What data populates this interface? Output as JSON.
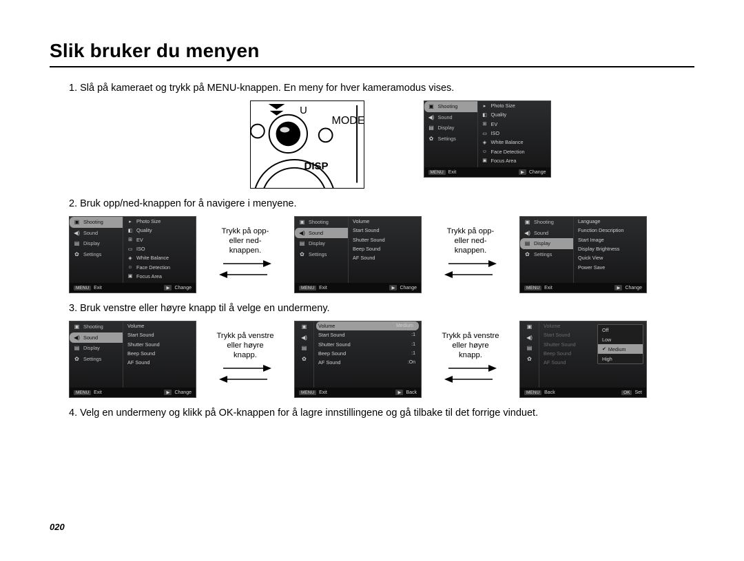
{
  "title": "Slik bruker du menyen",
  "steps": {
    "s1": "1. Slå på kameraet og trykk på MENU-knappen. En meny for hver kameramodus vises.",
    "s2": "2. Bruk opp/ned-knappen for å navigere i menyene.",
    "s3": "3. Bruk venstre eller høyre knapp til å velge en undermeny.",
    "s4": "4. Velg en undermeny og klikk på OK-knappen for å lagre innstillingene og gå tilbake til det forrige vinduet."
  },
  "camera_labels": {
    "mode": "MODE",
    "disp": "DISP"
  },
  "tabs": {
    "shooting": "Shooting",
    "sound": "Sound",
    "display": "Display",
    "settings": "Settings"
  },
  "shooting_items": [
    "Photo Size",
    "Quality",
    "EV",
    "ISO",
    "White Balance",
    "Face Detection",
    "Focus Area"
  ],
  "sound_items": [
    "Volume",
    "Start Sound",
    "Shutter Sound",
    "Beep Sound",
    "AF Sound"
  ],
  "display_items": [
    "Language",
    "Function Description",
    "Start Image",
    "Display Brightness",
    "Quick View",
    "Power Save"
  ],
  "sound_values": {
    "volume": "Medium",
    "start": ":1",
    "shutter": ":1",
    "beep": ":1",
    "af": ":On"
  },
  "volume_opts": [
    "Off",
    "Low",
    "Medium",
    "High"
  ],
  "footer": {
    "exit": "Exit",
    "change": "Change",
    "back": "Back",
    "set": "Set",
    "menu": "MENU",
    "play": "▶",
    "ok": "OK"
  },
  "arrows": {
    "updown": "Trykk på opp- eller ned-knappen.",
    "lr": "Trykk på venstre eller høyre knapp."
  },
  "page_num": "020"
}
